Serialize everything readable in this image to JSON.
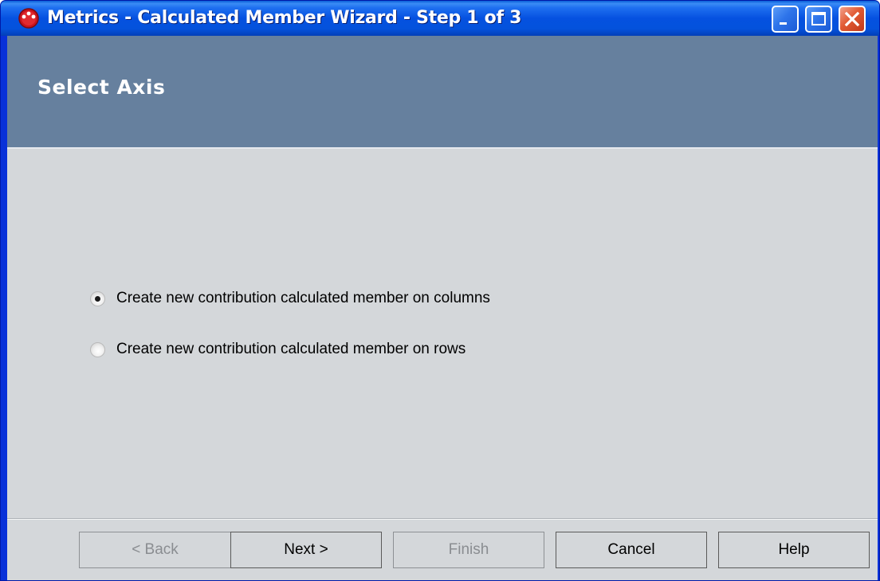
{
  "window": {
    "title": "Metrics - Calculated Member Wizard - Step 1 of 3",
    "app_icon": "metrics-app-icon",
    "controls": {
      "minimize_icon": "minimize-icon",
      "maximize_icon": "maximize-icon",
      "close_icon": "close-icon"
    }
  },
  "header": {
    "title": "Select Axis"
  },
  "options": [
    {
      "label": "Create new contribution calculated member on columns",
      "checked": true
    },
    {
      "label": "Create new contribution calculated member on rows",
      "checked": false
    }
  ],
  "buttons": {
    "back": {
      "label": "< Back",
      "enabled": false
    },
    "next": {
      "label": "Next >",
      "enabled": true
    },
    "finish": {
      "label": "Finish",
      "enabled": false
    },
    "cancel": {
      "label": "Cancel",
      "enabled": true
    },
    "help": {
      "label": "Help",
      "enabled": true
    }
  },
  "colors": {
    "title_bar": "#0551e0",
    "header_band": "#66809e",
    "client_bg": "#d4d7da",
    "close_button": "#e15b34"
  }
}
